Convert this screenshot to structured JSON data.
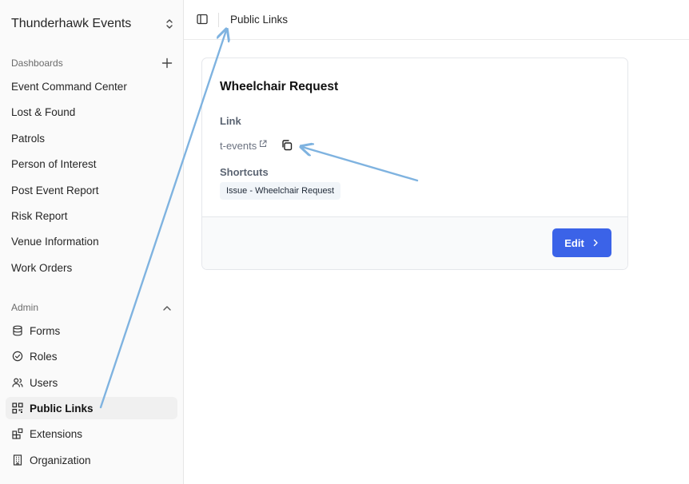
{
  "sidebar": {
    "org_name": "Thunderhawk Events",
    "dashboards_label": "Dashboards",
    "dashboards": [
      "Event Command Center",
      "Lost & Found",
      "Patrols",
      "Person of Interest",
      "Post Event Report",
      "Risk Report",
      "Venue Information",
      "Work Orders"
    ],
    "admin_label": "Admin",
    "admin_items": [
      {
        "label": "Forms",
        "icon": "database-icon"
      },
      {
        "label": "Roles",
        "icon": "check-circle-icon"
      },
      {
        "label": "Users",
        "icon": "users-icon"
      },
      {
        "label": "Public Links",
        "icon": "qr-code-icon",
        "active": true
      },
      {
        "label": "Extensions",
        "icon": "blocks-icon"
      },
      {
        "label": "Organization",
        "icon": "building-icon"
      }
    ]
  },
  "header": {
    "title": "Public Links"
  },
  "card": {
    "title": "Wheelchair Request",
    "link_label": "Link",
    "link_text": "t-events",
    "shortcuts_label": "Shortcuts",
    "shortcut_chip": "Issue - Wheelchair Request",
    "edit_label": "Edit"
  },
  "colors": {
    "accent": "#3b63e8",
    "annotation_arrow": "#7fb3e0"
  }
}
